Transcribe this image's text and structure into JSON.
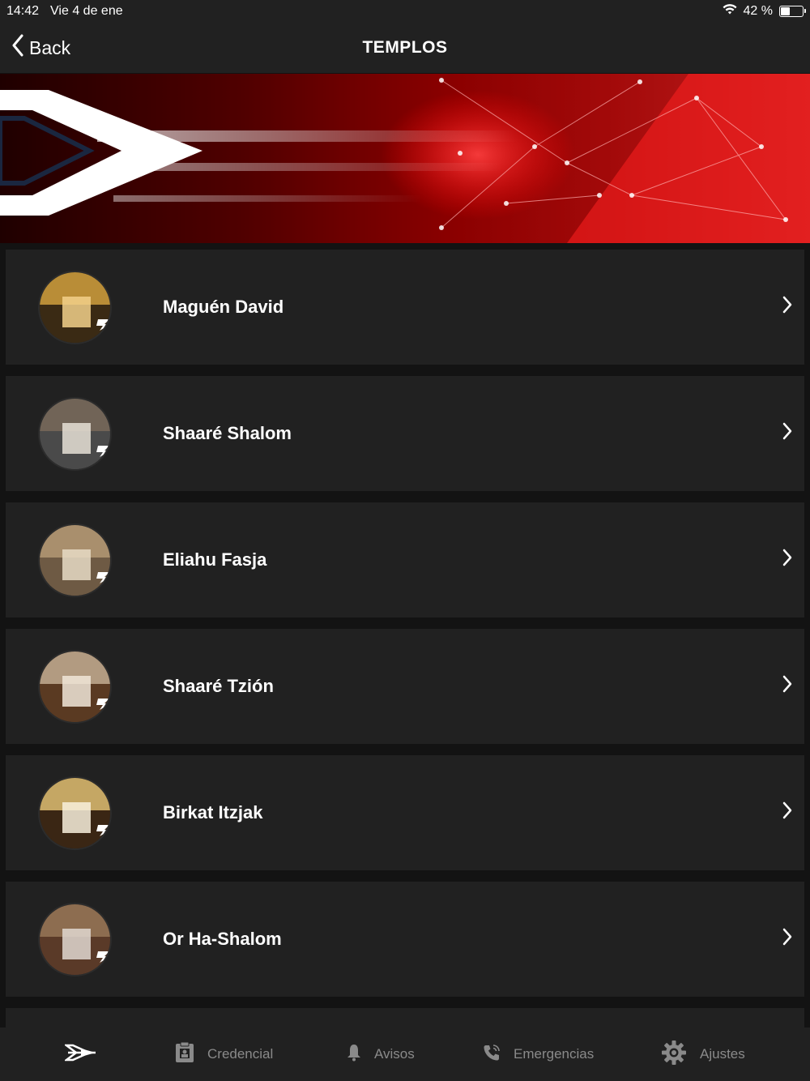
{
  "status_bar": {
    "time": "14:42",
    "date": "Vie 4 de ene",
    "battery_percent": "42 %",
    "battery_level": 0.42
  },
  "nav": {
    "back_label": "Back",
    "title": "TEMPLOS"
  },
  "temples": [
    {
      "name": "Maguén David"
    },
    {
      "name": "Shaaré Shalom"
    },
    {
      "name": "Eliahu Fasja"
    },
    {
      "name": "Shaaré Tzión"
    },
    {
      "name": "Birkat Itzjak"
    },
    {
      "name": "Or Ha-Shalom"
    }
  ],
  "tabs": [
    {
      "label": "",
      "icon": "home-logo-icon",
      "active": true
    },
    {
      "label": "Credencial",
      "icon": "id-card-icon"
    },
    {
      "label": "Avisos",
      "icon": "bell-icon"
    },
    {
      "label": "Emergencias",
      "icon": "phone-icon"
    },
    {
      "label": "Ajustes",
      "icon": "gear-icon"
    }
  ],
  "colors": {
    "background": "#131313",
    "bar": "#212121",
    "row": "#212121",
    "accent_red": "#d90d0d",
    "inactive_tab": "#8a8a8a"
  }
}
